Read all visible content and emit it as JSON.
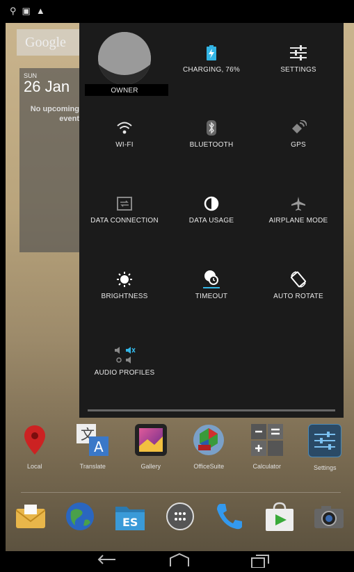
{
  "status_bar": {
    "icons": [
      "usb-icon",
      "image-icon",
      "warning-icon"
    ]
  },
  "home": {
    "google_bar": "Google",
    "calendar": {
      "day": "SUN",
      "date": "26 Jan",
      "empty_text": "No upcoming event"
    },
    "apps": [
      {
        "label": "Local",
        "icon": "map-pin-icon",
        "color": "#cc2222"
      },
      {
        "label": "Translate",
        "icon": "translate-icon",
        "color": "#3a78c8"
      },
      {
        "label": "Gallery",
        "icon": "gallery-icon",
        "color": "#7a3d8a"
      },
      {
        "label": "OfficeSuite",
        "icon": "officesuite-icon",
        "color": "#3a7ab8"
      },
      {
        "label": "Calculator",
        "icon": "calculator-icon",
        "color": "#444444"
      },
      {
        "label": "Settings",
        "icon": "settings-icon",
        "color": "#2a4a66"
      }
    ],
    "dock": [
      {
        "icon": "email-icon",
        "color": "#e8b64a"
      },
      {
        "icon": "browser-globe-icon",
        "color": "#2a66c0"
      },
      {
        "icon": "es-file-explorer-icon",
        "color": "#2b7ab0"
      },
      {
        "icon": "app-drawer-icon",
        "color": "#555555"
      },
      {
        "icon": "phone-icon",
        "color": "#3399ee"
      },
      {
        "icon": "play-store-icon",
        "color": "#dddddd"
      },
      {
        "icon": "camera-icon",
        "color": "#666666"
      }
    ]
  },
  "quick_settings": {
    "tiles": [
      {
        "id": "owner",
        "label": "OWNER",
        "icon": "owner-avatar-icon"
      },
      {
        "id": "battery",
        "label": "CHARGING, 76%",
        "icon": "battery-charging-icon"
      },
      {
        "id": "settings",
        "label": "SETTINGS",
        "icon": "settings-sliders-icon"
      },
      {
        "id": "wifi",
        "label": "WI-FI",
        "icon": "wifi-icon"
      },
      {
        "id": "bluetooth",
        "label": "BLUETOOTH",
        "icon": "bluetooth-icon"
      },
      {
        "id": "gps",
        "label": "GPS",
        "icon": "gps-icon"
      },
      {
        "id": "data_connection",
        "label": "DATA CONNECTION",
        "icon": "data-connection-icon"
      },
      {
        "id": "data_usage",
        "label": "DATA USAGE",
        "icon": "data-usage-icon"
      },
      {
        "id": "airplane",
        "label": "AIRPLANE MODE",
        "icon": "airplane-icon"
      },
      {
        "id": "brightness",
        "label": "BRIGHTNESS",
        "icon": "brightness-icon"
      },
      {
        "id": "timeout",
        "label": "TIMEOUT",
        "icon": "timeout-icon"
      },
      {
        "id": "auto_rotate",
        "label": "AUTO ROTATE",
        "icon": "auto-rotate-icon"
      },
      {
        "id": "audio_profiles",
        "label": "AUDIO PROFILES",
        "icon": "audio-profiles-icon"
      }
    ],
    "battery_level": 0.76
  },
  "nav_bar": {
    "buttons": [
      "back-icon",
      "home-icon",
      "recents-icon"
    ]
  }
}
